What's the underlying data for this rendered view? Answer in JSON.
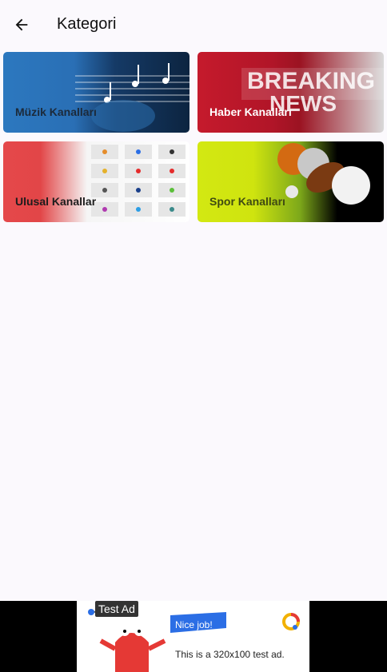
{
  "appbar": {
    "title": "Kategori"
  },
  "categories": [
    {
      "label": "Müzik Kanalları",
      "color": "#1c2a3a"
    },
    {
      "label": "Haber Kanalları",
      "color": "#ffffff"
    },
    {
      "label": "Ulusal Kanallar",
      "color": "#1c1c1c"
    },
    {
      "label": "Spor Kanalları",
      "color": "#3f4a12"
    }
  ],
  "ad": {
    "badge": "Test Ad",
    "banner_text": "Nice job!",
    "body": "This is a 320x100 test ad."
  }
}
